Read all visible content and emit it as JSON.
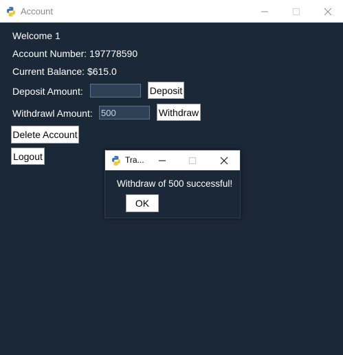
{
  "window": {
    "title": "Account",
    "icon": "python-icon"
  },
  "account": {
    "welcome": "Welcome 1",
    "account_number": "Account Number: 197778590",
    "balance": "Current Balance: $615.0"
  },
  "deposit": {
    "label": "Deposit Amount:",
    "value": "",
    "button": "Deposit"
  },
  "withdraw": {
    "label": "Withdrawl Amount:",
    "value": "500",
    "button": "Withdraw"
  },
  "actions": {
    "delete": "Delete Account",
    "logout": "Logout"
  },
  "dialog": {
    "title": "Tra...",
    "message": "Withdraw of 500 successful!",
    "ok": "OK"
  },
  "colors": {
    "background": "#1b2838",
    "entry_bg": "#2d4256",
    "text": "#ffffff"
  }
}
